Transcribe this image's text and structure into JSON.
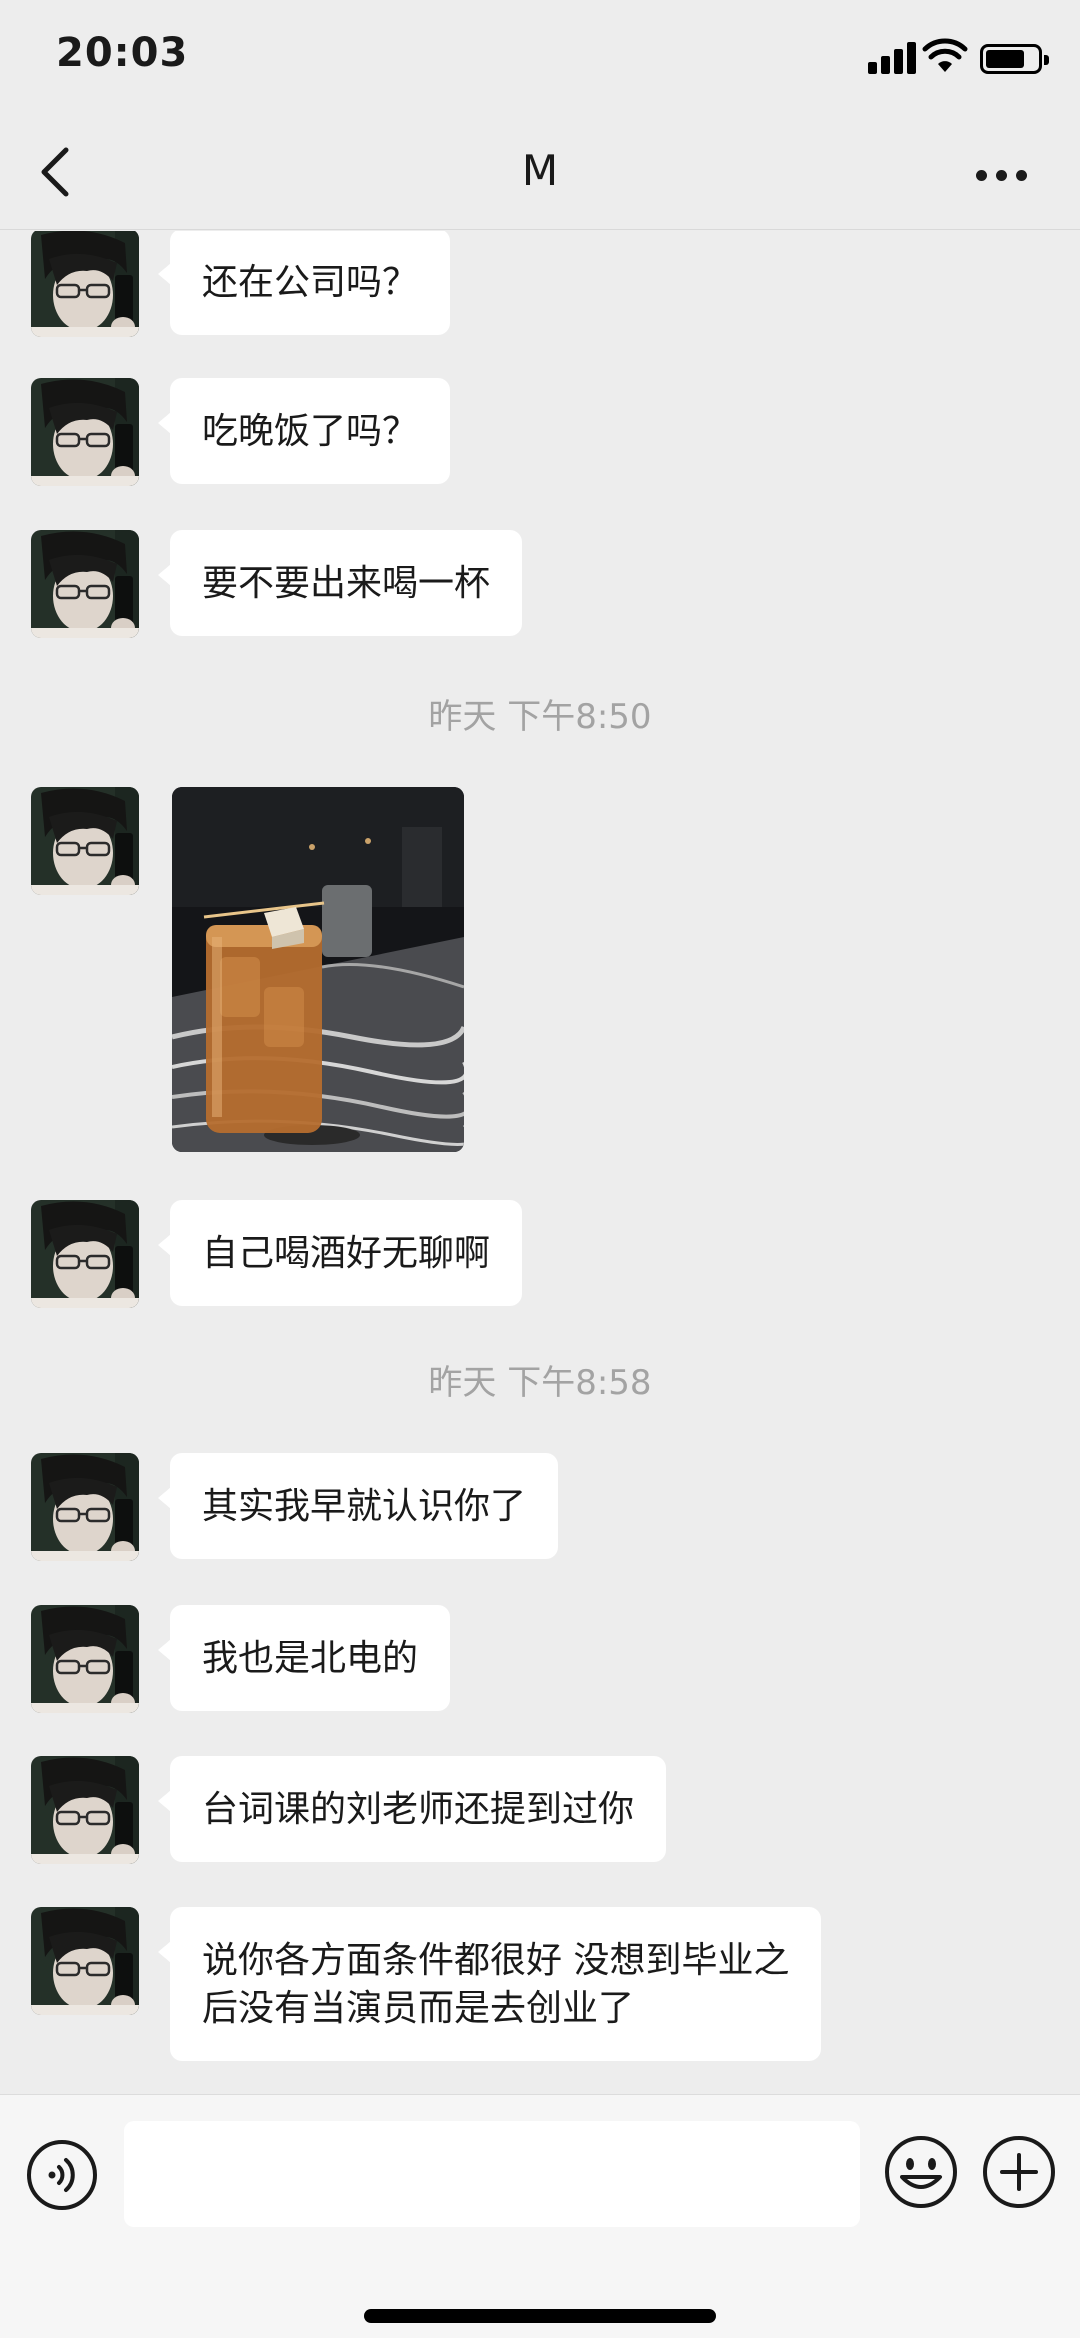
{
  "status_bar": {
    "time": "20:03"
  },
  "nav": {
    "title": "M"
  },
  "colors": {
    "background": "#ededed",
    "bubble": "#ffffff",
    "timestamp": "#a3a3a3",
    "input_bar": "#f6f6f6"
  },
  "messages": [
    {
      "type": "text",
      "text": "还在公司吗？"
    },
    {
      "type": "text",
      "text": "吃晚饭了吗？"
    },
    {
      "type": "text",
      "text": "要不要出来喝一杯"
    },
    {
      "type": "time",
      "text": "昨天 下午8:50"
    },
    {
      "type": "image",
      "content": "cocktail-photo"
    },
    {
      "type": "text",
      "text": "自己喝酒好无聊啊"
    },
    {
      "type": "time",
      "text": "昨天 下午8:58"
    },
    {
      "type": "text",
      "text": "其实我早就认识你了"
    },
    {
      "type": "text",
      "text": "我也是北电的"
    },
    {
      "type": "text",
      "text": "台词课的刘老师还提到过你"
    },
    {
      "type": "text",
      "text": "说你各方面条件都很好 没想到毕业之\n后没有当演员而是去创业了"
    }
  ],
  "input": {
    "value": "",
    "placeholder": ""
  },
  "icons": {
    "back": "chevron-left-icon",
    "more": "more-icon",
    "voice": "voice-icon",
    "emoji": "emoji-icon",
    "plus": "plus-icon"
  }
}
